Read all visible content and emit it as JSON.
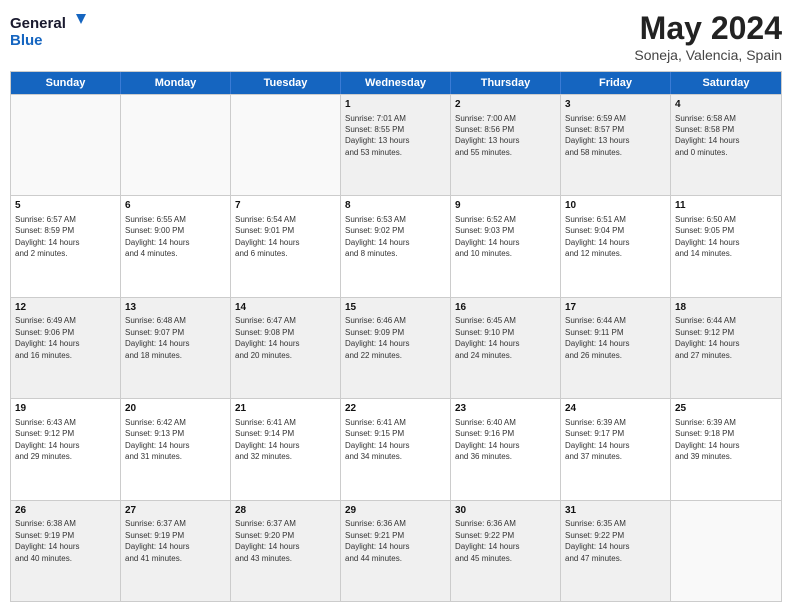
{
  "logo": {
    "line1": "General",
    "line2": "Blue"
  },
  "title": "May 2024",
  "subtitle": "Soneja, Valencia, Spain",
  "header_days": [
    "Sunday",
    "Monday",
    "Tuesday",
    "Wednesday",
    "Thursday",
    "Friday",
    "Saturday"
  ],
  "weeks": [
    [
      {
        "day": "",
        "info": ""
      },
      {
        "day": "",
        "info": ""
      },
      {
        "day": "",
        "info": ""
      },
      {
        "day": "1",
        "info": "Sunrise: 7:01 AM\nSunset: 8:55 PM\nDaylight: 13 hours\nand 53 minutes."
      },
      {
        "day": "2",
        "info": "Sunrise: 7:00 AM\nSunset: 8:56 PM\nDaylight: 13 hours\nand 55 minutes."
      },
      {
        "day": "3",
        "info": "Sunrise: 6:59 AM\nSunset: 8:57 PM\nDaylight: 13 hours\nand 58 minutes."
      },
      {
        "day": "4",
        "info": "Sunrise: 6:58 AM\nSunset: 8:58 PM\nDaylight: 14 hours\nand 0 minutes."
      }
    ],
    [
      {
        "day": "5",
        "info": "Sunrise: 6:57 AM\nSunset: 8:59 PM\nDaylight: 14 hours\nand 2 minutes."
      },
      {
        "day": "6",
        "info": "Sunrise: 6:55 AM\nSunset: 9:00 PM\nDaylight: 14 hours\nand 4 minutes."
      },
      {
        "day": "7",
        "info": "Sunrise: 6:54 AM\nSunset: 9:01 PM\nDaylight: 14 hours\nand 6 minutes."
      },
      {
        "day": "8",
        "info": "Sunrise: 6:53 AM\nSunset: 9:02 PM\nDaylight: 14 hours\nand 8 minutes."
      },
      {
        "day": "9",
        "info": "Sunrise: 6:52 AM\nSunset: 9:03 PM\nDaylight: 14 hours\nand 10 minutes."
      },
      {
        "day": "10",
        "info": "Sunrise: 6:51 AM\nSunset: 9:04 PM\nDaylight: 14 hours\nand 12 minutes."
      },
      {
        "day": "11",
        "info": "Sunrise: 6:50 AM\nSunset: 9:05 PM\nDaylight: 14 hours\nand 14 minutes."
      }
    ],
    [
      {
        "day": "12",
        "info": "Sunrise: 6:49 AM\nSunset: 9:06 PM\nDaylight: 14 hours\nand 16 minutes."
      },
      {
        "day": "13",
        "info": "Sunrise: 6:48 AM\nSunset: 9:07 PM\nDaylight: 14 hours\nand 18 minutes."
      },
      {
        "day": "14",
        "info": "Sunrise: 6:47 AM\nSunset: 9:08 PM\nDaylight: 14 hours\nand 20 minutes."
      },
      {
        "day": "15",
        "info": "Sunrise: 6:46 AM\nSunset: 9:09 PM\nDaylight: 14 hours\nand 22 minutes."
      },
      {
        "day": "16",
        "info": "Sunrise: 6:45 AM\nSunset: 9:10 PM\nDaylight: 14 hours\nand 24 minutes."
      },
      {
        "day": "17",
        "info": "Sunrise: 6:44 AM\nSunset: 9:11 PM\nDaylight: 14 hours\nand 26 minutes."
      },
      {
        "day": "18",
        "info": "Sunrise: 6:44 AM\nSunset: 9:12 PM\nDaylight: 14 hours\nand 27 minutes."
      }
    ],
    [
      {
        "day": "19",
        "info": "Sunrise: 6:43 AM\nSunset: 9:12 PM\nDaylight: 14 hours\nand 29 minutes."
      },
      {
        "day": "20",
        "info": "Sunrise: 6:42 AM\nSunset: 9:13 PM\nDaylight: 14 hours\nand 31 minutes."
      },
      {
        "day": "21",
        "info": "Sunrise: 6:41 AM\nSunset: 9:14 PM\nDaylight: 14 hours\nand 32 minutes."
      },
      {
        "day": "22",
        "info": "Sunrise: 6:41 AM\nSunset: 9:15 PM\nDaylight: 14 hours\nand 34 minutes."
      },
      {
        "day": "23",
        "info": "Sunrise: 6:40 AM\nSunset: 9:16 PM\nDaylight: 14 hours\nand 36 minutes."
      },
      {
        "day": "24",
        "info": "Sunrise: 6:39 AM\nSunset: 9:17 PM\nDaylight: 14 hours\nand 37 minutes."
      },
      {
        "day": "25",
        "info": "Sunrise: 6:39 AM\nSunset: 9:18 PM\nDaylight: 14 hours\nand 39 minutes."
      }
    ],
    [
      {
        "day": "26",
        "info": "Sunrise: 6:38 AM\nSunset: 9:19 PM\nDaylight: 14 hours\nand 40 minutes."
      },
      {
        "day": "27",
        "info": "Sunrise: 6:37 AM\nSunset: 9:19 PM\nDaylight: 14 hours\nand 41 minutes."
      },
      {
        "day": "28",
        "info": "Sunrise: 6:37 AM\nSunset: 9:20 PM\nDaylight: 14 hours\nand 43 minutes."
      },
      {
        "day": "29",
        "info": "Sunrise: 6:36 AM\nSunset: 9:21 PM\nDaylight: 14 hours\nand 44 minutes."
      },
      {
        "day": "30",
        "info": "Sunrise: 6:36 AM\nSunset: 9:22 PM\nDaylight: 14 hours\nand 45 minutes."
      },
      {
        "day": "31",
        "info": "Sunrise: 6:35 AM\nSunset: 9:22 PM\nDaylight: 14 hours\nand 47 minutes."
      },
      {
        "day": "",
        "info": ""
      }
    ]
  ]
}
